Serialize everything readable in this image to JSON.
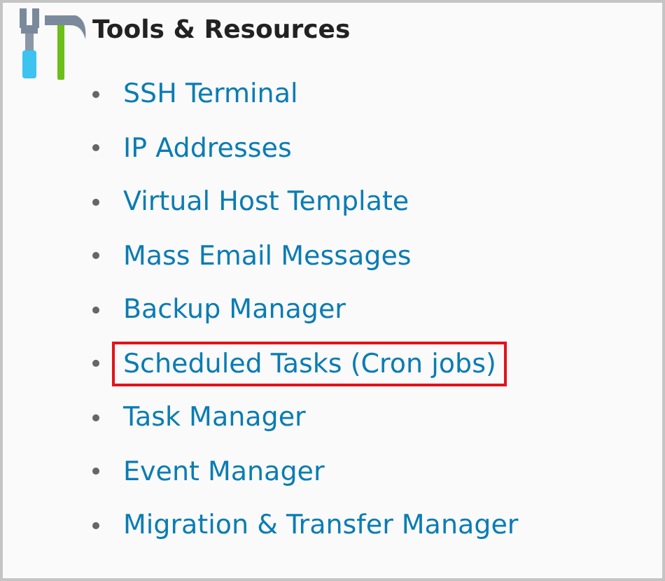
{
  "section": {
    "title": "Tools & Resources",
    "links": [
      {
        "label": "SSH Terminal",
        "highlighted": false
      },
      {
        "label": "IP Addresses",
        "highlighted": false
      },
      {
        "label": "Virtual Host Template",
        "highlighted": false
      },
      {
        "label": "Mass Email Messages",
        "highlighted": false
      },
      {
        "label": "Backup Manager",
        "highlighted": false
      },
      {
        "label": "Scheduled Tasks (Cron jobs)",
        "highlighted": true
      },
      {
        "label": "Task Manager",
        "highlighted": false
      },
      {
        "label": "Event Manager",
        "highlighted": false
      },
      {
        "label": "Migration & Transfer Manager",
        "highlighted": false
      }
    ]
  }
}
